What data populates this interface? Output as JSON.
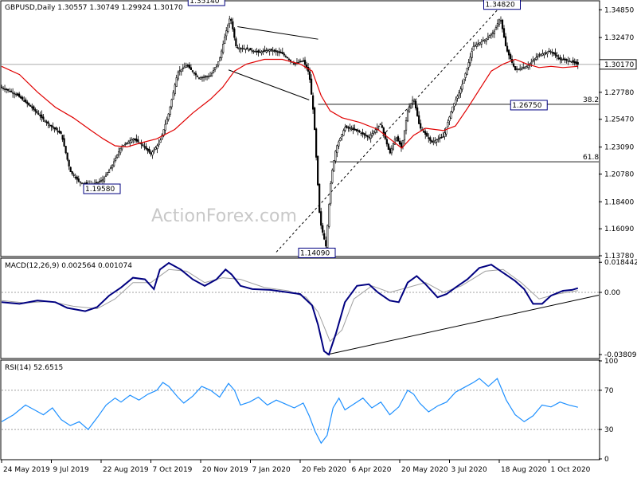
{
  "chart_data": {
    "type": "candlestick",
    "title": "GBPUSD,Daily  1.30557 1.30749 1.29924 1.30170",
    "watermark": "ActionForex.com",
    "colors": {
      "candle": "#000000",
      "ma": "#e00000",
      "macd": "#000080",
      "signal": "#a0a0a0",
      "rsi": "#1e90ff",
      "grid": "#a0a0a0"
    },
    "price": {
      "ylim": [
        1.1378,
        1.3555
      ],
      "yticks": [
        "1.34850",
        "1.32470",
        "1.30170",
        "1.27780",
        "1.25470",
        "1.23090",
        "1.20780",
        "1.18400",
        "1.16090",
        "1.13780"
      ],
      "current": "1.30170",
      "levels": [
        {
          "label": "38.2",
          "value": 1.2675
        },
        {
          "label": "61.8",
          "value": 1.2183
        }
      ],
      "annotations": [
        "1.35140",
        "1.34820",
        "1.26750",
        "1.19580",
        "1.14090"
      ],
      "fib_line": {
        "from": [
          0.46,
          1.1409
        ],
        "to": [
          0.83,
          1.3482
        ]
      },
      "triangle": {
        "upper": [
          [
            0.395,
            1.334
          ],
          [
            0.53,
            1.3233
          ]
        ],
        "lower": [
          [
            0.38,
            1.297
          ],
          [
            0.515,
            1.2713
          ]
        ]
      },
      "points": [
        [
          0.0,
          1.282
        ],
        [
          0.025,
          1.276
        ],
        [
          0.05,
          1.265
        ],
        [
          0.075,
          1.252
        ],
        [
          0.1,
          1.242
        ],
        [
          0.115,
          1.21
        ],
        [
          0.13,
          1.201
        ],
        [
          0.15,
          1.198
        ],
        [
          0.17,
          1.203
        ],
        [
          0.185,
          1.215
        ],
        [
          0.2,
          1.231
        ],
        [
          0.22,
          1.238
        ],
        [
          0.235,
          1.233
        ],
        [
          0.25,
          1.225
        ],
        [
          0.265,
          1.235
        ],
        [
          0.28,
          1.26
        ],
        [
          0.295,
          1.295
        ],
        [
          0.31,
          1.301
        ],
        [
          0.33,
          1.29
        ],
        [
          0.35,
          1.292
        ],
        [
          0.365,
          1.306
        ],
        [
          0.375,
          1.328
        ],
        [
          0.383,
          1.343
        ],
        [
          0.393,
          1.316
        ],
        [
          0.41,
          1.315
        ],
        [
          0.43,
          1.312
        ],
        [
          0.45,
          1.314
        ],
        [
          0.47,
          1.311
        ],
        [
          0.49,
          1.302
        ],
        [
          0.505,
          1.305
        ],
        [
          0.515,
          1.294
        ],
        [
          0.523,
          1.256
        ],
        [
          0.533,
          1.168
        ],
        [
          0.543,
          1.146
        ],
        [
          0.552,
          1.206
        ],
        [
          0.56,
          1.23
        ],
        [
          0.575,
          1.248
        ],
        [
          0.595,
          1.245
        ],
        [
          0.615,
          1.239
        ],
        [
          0.635,
          1.251
        ],
        [
          0.65,
          1.225
        ],
        [
          0.66,
          1.24
        ],
        [
          0.67,
          1.23
        ],
        [
          0.68,
          1.262
        ],
        [
          0.69,
          1.273
        ],
        [
          0.7,
          1.248
        ],
        [
          0.72,
          1.235
        ],
        [
          0.74,
          1.24
        ],
        [
          0.755,
          1.265
        ],
        [
          0.77,
          1.282
        ],
        [
          0.79,
          1.317
        ],
        [
          0.81,
          1.323
        ],
        [
          0.825,
          1.33
        ],
        [
          0.835,
          1.342
        ],
        [
          0.845,
          1.315
        ],
        [
          0.86,
          1.297
        ],
        [
          0.88,
          1.3
        ],
        [
          0.9,
          1.31
        ],
        [
          0.92,
          1.313
        ],
        [
          0.935,
          1.306
        ],
        [
          0.95,
          1.305
        ],
        [
          0.965,
          1.3017
        ]
      ],
      "ma_points": [
        [
          0.0,
          1.3
        ],
        [
          0.03,
          1.293
        ],
        [
          0.06,
          1.278
        ],
        [
          0.09,
          1.265
        ],
        [
          0.12,
          1.256
        ],
        [
          0.15,
          1.245
        ],
        [
          0.17,
          1.238
        ],
        [
          0.19,
          1.232
        ],
        [
          0.21,
          1.231
        ],
        [
          0.23,
          1.234
        ],
        [
          0.26,
          1.238
        ],
        [
          0.29,
          1.246
        ],
        [
          0.32,
          1.26
        ],
        [
          0.35,
          1.272
        ],
        [
          0.37,
          1.282
        ],
        [
          0.39,
          1.296
        ],
        [
          0.41,
          1.302
        ],
        [
          0.44,
          1.306
        ],
        [
          0.47,
          1.306
        ],
        [
          0.5,
          1.302
        ],
        [
          0.52,
          1.296
        ],
        [
          0.535,
          1.275
        ],
        [
          0.55,
          1.262
        ],
        [
          0.57,
          1.256
        ],
        [
          0.6,
          1.252
        ],
        [
          0.63,
          1.246
        ],
        [
          0.65,
          1.238
        ],
        [
          0.67,
          1.23
        ],
        [
          0.69,
          1.241
        ],
        [
          0.71,
          1.247
        ],
        [
          0.74,
          1.245
        ],
        [
          0.76,
          1.249
        ],
        [
          0.78,
          1.264
        ],
        [
          0.8,
          1.28
        ],
        [
          0.82,
          1.296
        ],
        [
          0.84,
          1.302
        ],
        [
          0.86,
          1.306
        ],
        [
          0.88,
          1.302
        ],
        [
          0.9,
          1.299
        ],
        [
          0.92,
          1.3
        ],
        [
          0.94,
          1.299
        ],
        [
          0.965,
          1.3
        ]
      ]
    },
    "macd": {
      "label": "MACD(12,26,9) 0.002564 0.001074",
      "ylim": [
        -0.04,
        0.0205
      ],
      "yticks": [
        "0.018442",
        "0.00",
        "-0.038095"
      ],
      "trendline": {
        "from": [
          0.545,
          -0.0381
        ],
        "to": [
          1.0,
          -0.0017
        ]
      },
      "macd_points": [
        [
          0.0,
          -0.006
        ],
        [
          0.03,
          -0.007
        ],
        [
          0.06,
          -0.005
        ],
        [
          0.09,
          -0.006
        ],
        [
          0.11,
          -0.0095
        ],
        [
          0.14,
          -0.0115
        ],
        [
          0.16,
          -0.009
        ],
        [
          0.18,
          -0.002
        ],
        [
          0.2,
          0.003
        ],
        [
          0.22,
          0.009
        ],
        [
          0.24,
          0.008
        ],
        [
          0.255,
          0.002
        ],
        [
          0.265,
          0.014
        ],
        [
          0.28,
          0.018
        ],
        [
          0.3,
          0.014
        ],
        [
          0.32,
          0.008
        ],
        [
          0.34,
          0.004
        ],
        [
          0.36,
          0.008
        ],
        [
          0.375,
          0.014
        ],
        [
          0.385,
          0.011
        ],
        [
          0.4,
          0.004
        ],
        [
          0.42,
          0.002
        ],
        [
          0.45,
          0.0015
        ],
        [
          0.48,
          0.0
        ],
        [
          0.5,
          -0.001
        ],
        [
          0.52,
          -0.008
        ],
        [
          0.53,
          -0.02
        ],
        [
          0.54,
          -0.036
        ],
        [
          0.548,
          -0.0381
        ],
        [
          0.56,
          -0.025
        ],
        [
          0.575,
          -0.006
        ],
        [
          0.595,
          0.004
        ],
        [
          0.615,
          0.005
        ],
        [
          0.63,
          0.0
        ],
        [
          0.65,
          -0.005
        ],
        [
          0.665,
          -0.006
        ],
        [
          0.68,
          0.006
        ],
        [
          0.695,
          0.01
        ],
        [
          0.71,
          0.005
        ],
        [
          0.73,
          -0.003
        ],
        [
          0.745,
          -0.001
        ],
        [
          0.76,
          0.003
        ],
        [
          0.78,
          0.008
        ],
        [
          0.8,
          0.015
        ],
        [
          0.82,
          0.017
        ],
        [
          0.84,
          0.012
        ],
        [
          0.86,
          0.007
        ],
        [
          0.875,
          0.002
        ],
        [
          0.89,
          -0.007
        ],
        [
          0.905,
          -0.007
        ],
        [
          0.92,
          -0.002
        ],
        [
          0.94,
          0.001
        ],
        [
          0.955,
          0.0015
        ],
        [
          0.965,
          0.0026
        ]
      ],
      "signal_points": [
        [
          0.0,
          -0.005
        ],
        [
          0.04,
          -0.0065
        ],
        [
          0.08,
          -0.0055
        ],
        [
          0.12,
          -0.0085
        ],
        [
          0.16,
          -0.01
        ],
        [
          0.19,
          -0.004
        ],
        [
          0.22,
          0.006
        ],
        [
          0.25,
          0.006
        ],
        [
          0.28,
          0.014
        ],
        [
          0.31,
          0.013
        ],
        [
          0.34,
          0.006
        ],
        [
          0.37,
          0.009
        ],
        [
          0.4,
          0.008
        ],
        [
          0.44,
          0.003
        ],
        [
          0.48,
          0.001
        ],
        [
          0.51,
          -0.003
        ],
        [
          0.53,
          -0.012
        ],
        [
          0.55,
          -0.03
        ],
        [
          0.57,
          -0.023
        ],
        [
          0.59,
          -0.004
        ],
        [
          0.62,
          0.004
        ],
        [
          0.65,
          0.0
        ],
        [
          0.68,
          0.003
        ],
        [
          0.71,
          0.006
        ],
        [
          0.74,
          0.0
        ],
        [
          0.77,
          0.004
        ],
        [
          0.81,
          0.013
        ],
        [
          0.84,
          0.014
        ],
        [
          0.87,
          0.006
        ],
        [
          0.9,
          -0.004
        ],
        [
          0.93,
          -0.001
        ],
        [
          0.965,
          0.0011
        ]
      ]
    },
    "rsi": {
      "label": "RSI(14) 52.6515",
      "ylim": [
        0,
        100
      ],
      "yticks": [
        "100",
        "70",
        "30",
        "0"
      ],
      "levels": [
        70,
        30
      ],
      "points": [
        [
          0.0,
          38
        ],
        [
          0.02,
          45
        ],
        [
          0.04,
          55
        ],
        [
          0.055,
          50
        ],
        [
          0.07,
          45
        ],
        [
          0.085,
          52
        ],
        [
          0.1,
          40
        ],
        [
          0.115,
          34
        ],
        [
          0.13,
          38
        ],
        [
          0.145,
          30
        ],
        [
          0.16,
          42
        ],
        [
          0.175,
          55
        ],
        [
          0.19,
          62
        ],
        [
          0.2,
          58
        ],
        [
          0.215,
          65
        ],
        [
          0.23,
          60
        ],
        [
          0.245,
          66
        ],
        [
          0.26,
          70
        ],
        [
          0.27,
          78
        ],
        [
          0.28,
          74
        ],
        [
          0.295,
          63
        ],
        [
          0.305,
          57
        ],
        [
          0.32,
          64
        ],
        [
          0.335,
          74
        ],
        [
          0.35,
          70
        ],
        [
          0.365,
          63
        ],
        [
          0.38,
          77
        ],
        [
          0.39,
          70
        ],
        [
          0.4,
          55
        ],
        [
          0.415,
          58
        ],
        [
          0.43,
          63
        ],
        [
          0.445,
          55
        ],
        [
          0.46,
          60
        ],
        [
          0.475,
          56
        ],
        [
          0.49,
          52
        ],
        [
          0.505,
          57
        ],
        [
          0.515,
          44
        ],
        [
          0.525,
          28
        ],
        [
          0.535,
          16
        ],
        [
          0.545,
          24
        ],
        [
          0.555,
          52
        ],
        [
          0.565,
          62
        ],
        [
          0.575,
          50
        ],
        [
          0.59,
          56
        ],
        [
          0.605,
          62
        ],
        [
          0.62,
          52
        ],
        [
          0.635,
          58
        ],
        [
          0.65,
          45
        ],
        [
          0.665,
          53
        ],
        [
          0.68,
          70
        ],
        [
          0.69,
          66
        ],
        [
          0.7,
          57
        ],
        [
          0.715,
          48
        ],
        [
          0.73,
          54
        ],
        [
          0.745,
          58
        ],
        [
          0.76,
          68
        ],
        [
          0.775,
          73
        ],
        [
          0.79,
          78
        ],
        [
          0.8,
          82
        ],
        [
          0.815,
          74
        ],
        [
          0.83,
          82
        ],
        [
          0.845,
          60
        ],
        [
          0.86,
          45
        ],
        [
          0.875,
          38
        ],
        [
          0.89,
          44
        ],
        [
          0.905,
          55
        ],
        [
          0.92,
          53
        ],
        [
          0.935,
          58
        ],
        [
          0.95,
          55
        ],
        [
          0.965,
          52.65
        ]
      ]
    },
    "xticks": [
      "24 May 2019",
      "9 Jul 2019",
      "22 Aug 2019",
      "7 Oct 2019",
      "20 Nov 2019",
      "7 Jan 2020",
      "20 Feb 2020",
      "6 Apr 2020",
      "20 May 2020",
      "3 Jul 2020",
      "18 Aug 2020",
      "1 Oct 2020"
    ]
  }
}
